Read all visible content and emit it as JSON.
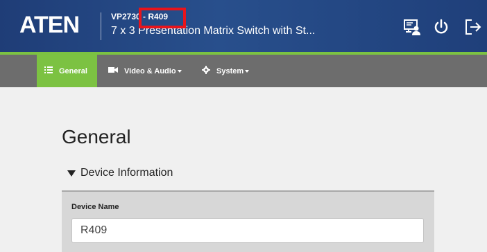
{
  "header": {
    "logo": "ATEN",
    "model": "VP2730 - R409",
    "subtitle": "7 x 3 Presentation Matrix Switch with St...",
    "icons": [
      "user-monitor-icon",
      "power-icon",
      "logout-icon"
    ],
    "colors": {
      "bar": "#284f8c",
      "accent": "#7cc242",
      "highlight": "#e8141b"
    }
  },
  "nav": {
    "items": [
      {
        "label": "General",
        "icon": "list-icon",
        "active": true,
        "dropdown": false
      },
      {
        "label": "Video & Audio",
        "icon": "video-icon",
        "active": false,
        "dropdown": true
      },
      {
        "label": "System",
        "icon": "gear-icon",
        "active": false,
        "dropdown": true
      }
    ]
  },
  "main": {
    "title": "General",
    "section": "Device Information",
    "device_name_label": "Device Name",
    "device_name_value": "R409"
  }
}
